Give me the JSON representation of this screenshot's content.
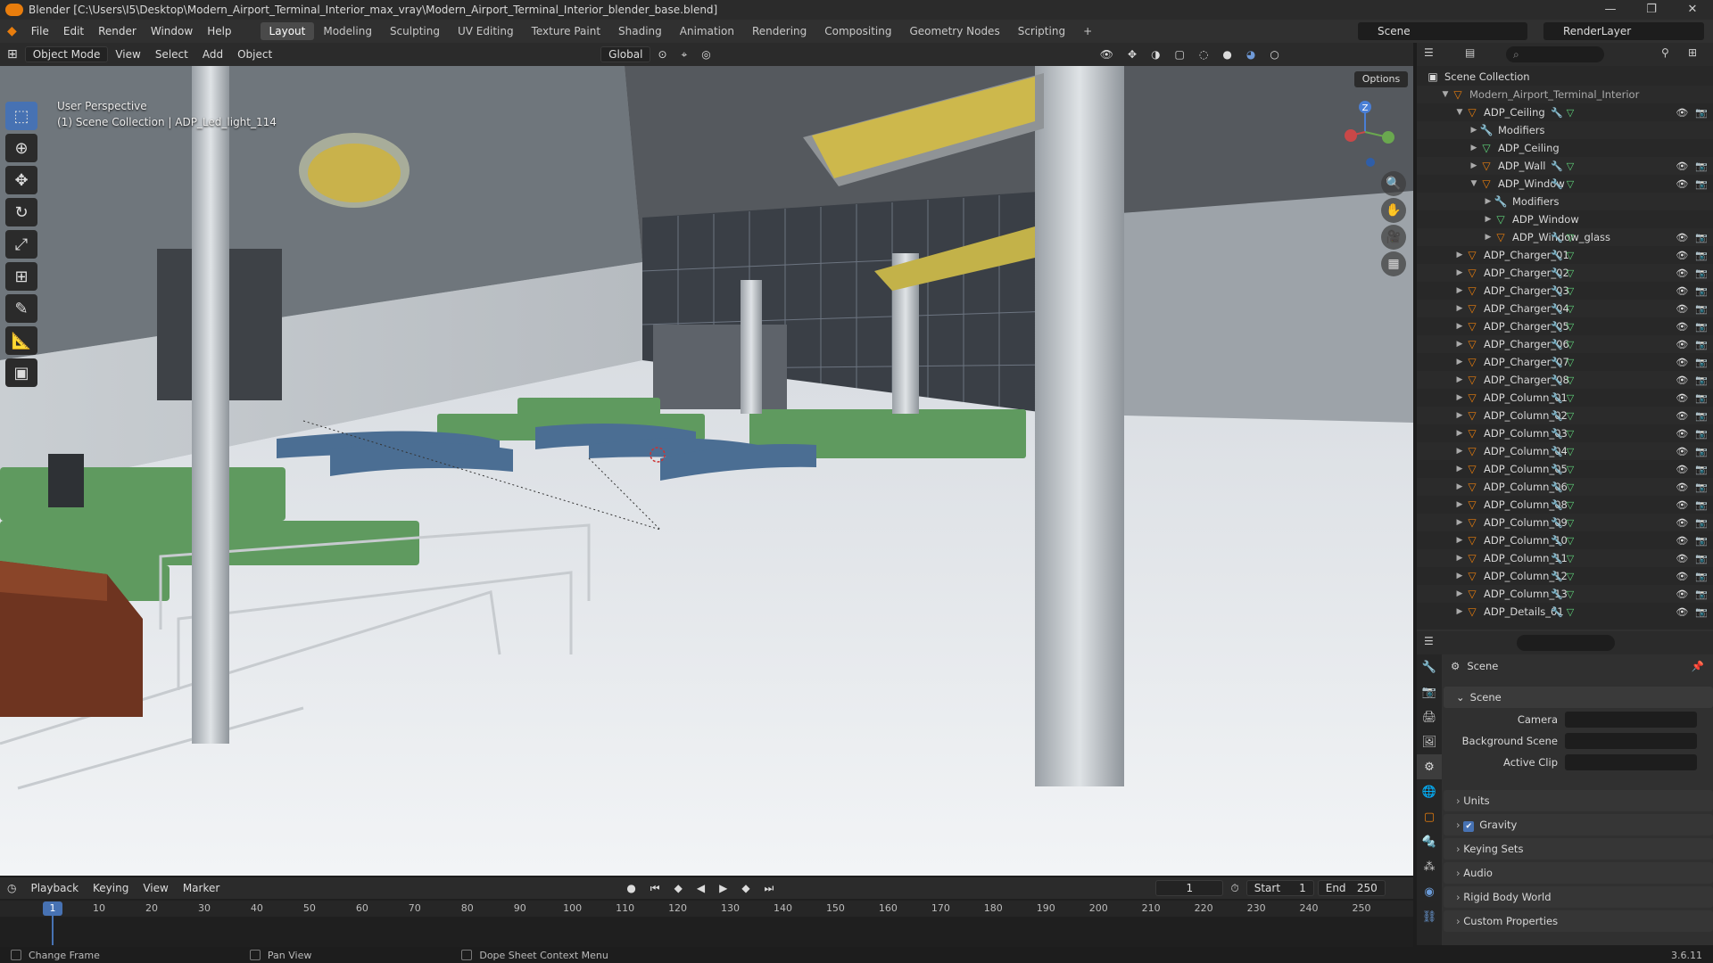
{
  "window": {
    "title": "Blender [C:\\Users\\I5\\Desktop\\Modern_Airport_Terminal_Interior_max_vray\\Modern_Airport_Terminal_Interior_blender_base.blend]",
    "controls": [
      "—",
      "❐",
      "✕"
    ]
  },
  "menu": {
    "items": [
      "File",
      "Edit",
      "Render",
      "Window",
      "Help"
    ],
    "workspaces": [
      "Layout",
      "Modeling",
      "Sculpting",
      "UV Editing",
      "Texture Paint",
      "Shading",
      "Animation",
      "Rendering",
      "Compositing",
      "Geometry Nodes",
      "Scripting"
    ],
    "active_workspace": "Layout",
    "add_tab": "+",
    "scene": "Scene",
    "render_layer": "RenderLayer"
  },
  "viewport_header": {
    "mode": "Object Mode",
    "menus": [
      "View",
      "Select",
      "Add",
      "Object"
    ],
    "orientation": "Global",
    "options": "Options"
  },
  "viewport": {
    "perspective": "User Perspective",
    "context": "(1) Scene Collection | ADP_Led_light_114",
    "gizmo_z": "Z"
  },
  "outliner": {
    "root": "Scene Collection",
    "collection": "Modern_Airport_Terminal_Interior",
    "rows": [
      {
        "label": "ADP_Ceiling",
        "indent": 2,
        "type": "object",
        "expanded": true
      },
      {
        "label": "Modifiers",
        "indent": 3,
        "type": "modifier"
      },
      {
        "label": "ADP_Ceiling",
        "indent": 3,
        "type": "mesh"
      },
      {
        "label": "ADP_Wall",
        "indent": 3,
        "type": "object"
      },
      {
        "label": "ADP_Window",
        "indent": 3,
        "type": "object",
        "expanded": true
      },
      {
        "label": "Modifiers",
        "indent": 4,
        "type": "modifier"
      },
      {
        "label": "ADP_Window",
        "indent": 4,
        "type": "mesh"
      },
      {
        "label": "ADP_Window_glass",
        "indent": 4,
        "type": "object"
      },
      {
        "label": "ADP_Charger_01",
        "indent": 2,
        "type": "object"
      },
      {
        "label": "ADP_Charger_02",
        "indent": 2,
        "type": "object"
      },
      {
        "label": "ADP_Charger_03",
        "indent": 2,
        "type": "object"
      },
      {
        "label": "ADP_Charger_04",
        "indent": 2,
        "type": "object"
      },
      {
        "label": "ADP_Charger_05",
        "indent": 2,
        "type": "object"
      },
      {
        "label": "ADP_Charger_06",
        "indent": 2,
        "type": "object"
      },
      {
        "label": "ADP_Charger_07",
        "indent": 2,
        "type": "object"
      },
      {
        "label": "ADP_Charger_08",
        "indent": 2,
        "type": "object"
      },
      {
        "label": "ADP_Column_01",
        "indent": 2,
        "type": "object"
      },
      {
        "label": "ADP_Column_02",
        "indent": 2,
        "type": "object"
      },
      {
        "label": "ADP_Column_03",
        "indent": 2,
        "type": "object"
      },
      {
        "label": "ADP_Column_04",
        "indent": 2,
        "type": "object"
      },
      {
        "label": "ADP_Column_05",
        "indent": 2,
        "type": "object"
      },
      {
        "label": "ADP_Column_06",
        "indent": 2,
        "type": "object"
      },
      {
        "label": "ADP_Column_08",
        "indent": 2,
        "type": "object"
      },
      {
        "label": "ADP_Column_09",
        "indent": 2,
        "type": "object"
      },
      {
        "label": "ADP_Column_10",
        "indent": 2,
        "type": "object"
      },
      {
        "label": "ADP_Column_11",
        "indent": 2,
        "type": "object"
      },
      {
        "label": "ADP_Column_12",
        "indent": 2,
        "type": "object"
      },
      {
        "label": "ADP_Column_13",
        "indent": 2,
        "type": "object"
      },
      {
        "label": "ADP_Details_01",
        "indent": 2,
        "type": "object"
      }
    ]
  },
  "properties": {
    "context": "Scene",
    "panel": "Scene",
    "fields": [
      {
        "label": "Camera",
        "value": ""
      },
      {
        "label": "Background Scene",
        "value": ""
      },
      {
        "label": "Active Clip",
        "value": ""
      }
    ],
    "subpanels": [
      {
        "label": "Units",
        "checkbox": false
      },
      {
        "label": "Gravity",
        "checkbox": true
      },
      {
        "label": "Keying Sets",
        "checkbox": false
      },
      {
        "label": "Audio",
        "checkbox": false
      },
      {
        "label": "Rigid Body World",
        "checkbox": false
      },
      {
        "label": "Custom Properties",
        "checkbox": false
      }
    ]
  },
  "timeline": {
    "menus": [
      "Playback",
      "Keying",
      "View",
      "Marker"
    ],
    "current_frame": "1",
    "start_label": "Start",
    "start": "1",
    "end_label": "End",
    "end": "250",
    "ticks": [
      "1",
      "10",
      "20",
      "30",
      "40",
      "50",
      "60",
      "70",
      "80",
      "90",
      "100",
      "110",
      "120",
      "130",
      "140",
      "150",
      "160",
      "170",
      "180",
      "190",
      "200",
      "210",
      "220",
      "230",
      "240",
      "250"
    ]
  },
  "statusbar": {
    "items": [
      "Change Frame",
      "Pan View",
      "Dope Sheet Context Menu"
    ],
    "version": "3.6.11"
  },
  "colors": {
    "accent": "#4772b3",
    "object_icon": "#e87d0d",
    "mesh_icon": "#5fd47a",
    "modifier_icon": "#6a9bd8",
    "material_icon": "#d85656"
  }
}
